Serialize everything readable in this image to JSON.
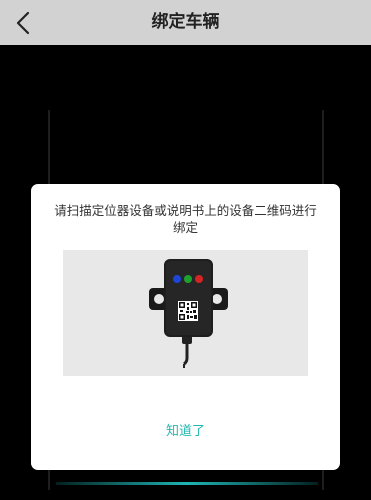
{
  "header": {
    "title": "绑定车辆",
    "back_icon": "chevron-left-icon"
  },
  "dialog": {
    "message": "请扫描定位器设备或说明书上的设备二维码进行绑定",
    "confirm_label": "知道了",
    "accent_color": "#23b8b0"
  },
  "device": {
    "led_colors": [
      "#1e46d6",
      "#1fa12e",
      "#d42424"
    ]
  }
}
